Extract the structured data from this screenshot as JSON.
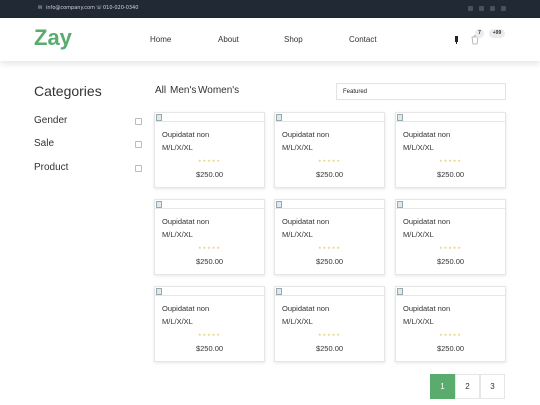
{
  "topbar": {
    "email": "info@company.com",
    "phone": "010-020-0340",
    "social_icons": [
      "facebook-icon",
      "instagram-icon",
      "twitter-icon",
      "linkedin-icon"
    ]
  },
  "nav": {
    "logo": "Zay",
    "menu": [
      "Home",
      "About",
      "Shop",
      "Contact"
    ],
    "cart_count": "7",
    "user_count": "+99"
  },
  "sidebar": {
    "title": "Categories",
    "items": [
      "Gender",
      "Sale",
      "Product"
    ]
  },
  "filters": {
    "tabs": [
      "All",
      "Men's",
      "Women's"
    ],
    "sort_value": "Featured"
  },
  "products": [
    {
      "name": "Oupidatat non",
      "sizes": "M/L/X/XL",
      "price": "$250.00",
      "stars": "★★★★★"
    },
    {
      "name": "Oupidatat non",
      "sizes": "M/L/X/XL",
      "price": "$250.00",
      "stars": "★★★★★"
    },
    {
      "name": "Oupidatat non",
      "sizes": "M/L/X/XL",
      "price": "$250.00",
      "stars": "★★★★★"
    },
    {
      "name": "Oupidatat non",
      "sizes": "M/L/X/XL",
      "price": "$250.00",
      "stars": "★★★★★"
    },
    {
      "name": "Oupidatat non",
      "sizes": "M/L/X/XL",
      "price": "$250.00",
      "stars": "★★★★★"
    },
    {
      "name": "Oupidatat non",
      "sizes": "M/L/X/XL",
      "price": "$250.00",
      "stars": "★★★★★"
    },
    {
      "name": "Oupidatat non",
      "sizes": "M/L/X/XL",
      "price": "$250.00",
      "stars": "★★★★★"
    },
    {
      "name": "Oupidatat non",
      "sizes": "M/L/X/XL",
      "price": "$250.00",
      "stars": "★★★★★"
    },
    {
      "name": "Oupidatat non",
      "sizes": "M/L/X/XL",
      "price": "$250.00",
      "stars": "★★★★★"
    }
  ],
  "pagination": [
    "1",
    "2",
    "3"
  ],
  "colors": {
    "accent": "#59ab6e",
    "topbar": "#212934"
  }
}
